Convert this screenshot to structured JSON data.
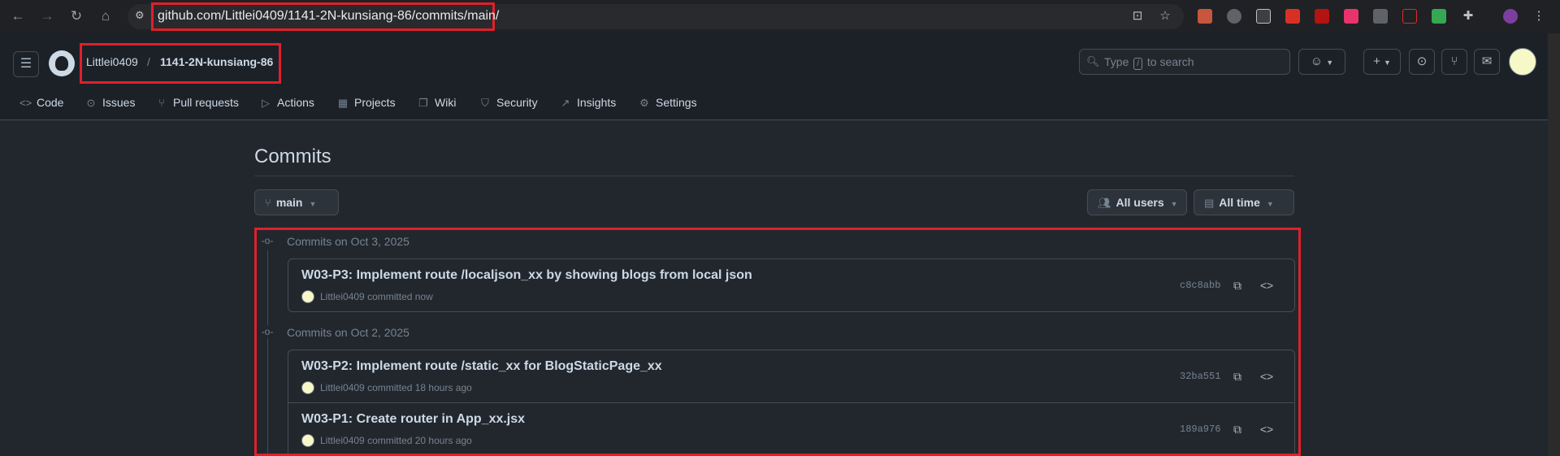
{
  "browser": {
    "url": "github.com/Littlei0409/1141-2N-kunsiang-86/commits/main/"
  },
  "header": {
    "owner": "Littlei0409",
    "separator": "/",
    "repo": "1141-2N-kunsiang-86",
    "search_prefix": "Type",
    "search_key": "/",
    "search_suffix": "to search"
  },
  "tabs": [
    {
      "label": "Code",
      "icon": "code-icon"
    },
    {
      "label": "Issues",
      "icon": "issue-icon"
    },
    {
      "label": "Pull requests",
      "icon": "pull-request-icon"
    },
    {
      "label": "Actions",
      "icon": "play-icon"
    },
    {
      "label": "Projects",
      "icon": "table-icon"
    },
    {
      "label": "Wiki",
      "icon": "book-icon"
    },
    {
      "label": "Security",
      "icon": "shield-icon"
    },
    {
      "label": "Insights",
      "icon": "graph-icon"
    },
    {
      "label": "Settings",
      "icon": "gear-icon"
    }
  ],
  "main": {
    "title": "Commits",
    "branch": "main",
    "users_filter": "All users",
    "time_filter": "All time"
  },
  "groups": [
    {
      "label": "Commits on Oct 3, 2025",
      "commits": [
        {
          "message": "W03-P3: Implement route /localjson_xx by showing blogs from local json",
          "author": "Littlei0409",
          "when": "committed now",
          "sha": "c8c8abb"
        }
      ]
    },
    {
      "label": "Commits on Oct 2, 2025",
      "commits": [
        {
          "message": "W03-P2: Implement route /static_xx for BlogStaticPage_xx",
          "author": "Littlei0409",
          "when": "committed 18 hours ago",
          "sha": "32ba551"
        },
        {
          "message": "W03-P1: Create router in App_xx.jsx",
          "author": "Littlei0409",
          "when": "committed 20 hours ago",
          "sha": "189a976"
        }
      ]
    }
  ],
  "colors": {
    "highlight": "#e0202a",
    "background": "#22272e",
    "header": "#1c2128"
  }
}
